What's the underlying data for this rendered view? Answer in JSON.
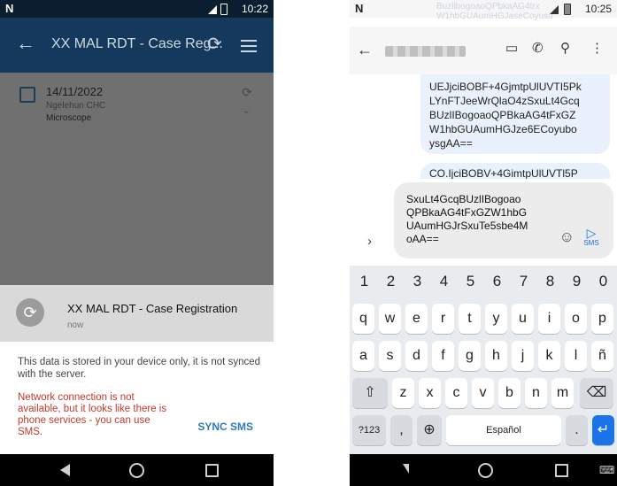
{
  "left": {
    "status": {
      "carrier_icon": "N",
      "time": "10:22"
    },
    "appbar": {
      "title": "XX MAL RDT - Case Reg...",
      "back_icon": "arrow-left-icon",
      "sync_icon": "sync-icon",
      "filter_icon": "filter-icon"
    },
    "card": {
      "date": "14/11/2022",
      "place": "Ngelehun CHC",
      "method": "Microscope"
    },
    "notification": {
      "title": "XX MAL RDT - Case Registration",
      "time": "now"
    },
    "info_text": "This data is stored in your device only, it is not synced with the server.",
    "warning_text": "Network connection is not available, but it looks like there is phone services - you can use SMS.",
    "sync_sms_label": "SYNC SMS",
    "colors": {
      "appbar": "#14395d",
      "warning": "#c0392b",
      "link": "#2d7ab8"
    }
  },
  "right": {
    "status": {
      "carrier_icon": "N",
      "time": "10:25"
    },
    "ghost_text": [
      "BuzllbogoaoQPbkaAG4trx",
      "W1hbGUAumHGJaseCoyusu"
    ],
    "message_1": [
      "UEJjciBOBF+4GjmtpUlUVTI5Pk",
      "LYnFTJeeWrQlaO4zSxuLt4Gcq",
      "BUzlIBogoaoQPBkaAG4tFxGZ",
      "W1hbGUAumHGJze6ECoyubo",
      "ysgAA=="
    ],
    "message_2": "CO.IjciBOBV+4GimtpUlUVTl5P",
    "compose_text": [
      "SxuLt4GcqBUzlIBogoao",
      "QPBkaAG4tFxGZW1hbG",
      "UAumHGJrSxuTe5sbe4M",
      "oAA=="
    ],
    "send_label": "SMS",
    "keyboard": {
      "numbers": [
        "1",
        "2",
        "3",
        "4",
        "5",
        "6",
        "7",
        "8",
        "9",
        "0"
      ],
      "row1": [
        "q",
        "w",
        "e",
        "r",
        "t",
        "y",
        "u",
        "i",
        "o",
        "p"
      ],
      "row2": [
        "a",
        "s",
        "d",
        "f",
        "g",
        "h",
        "j",
        "k",
        "l",
        "ñ"
      ],
      "row3": [
        "z",
        "x",
        "c",
        "v",
        "b",
        "n",
        "m"
      ],
      "sym_label": "?123",
      "comma": ",",
      "space_label": "Español",
      "period": "."
    }
  }
}
